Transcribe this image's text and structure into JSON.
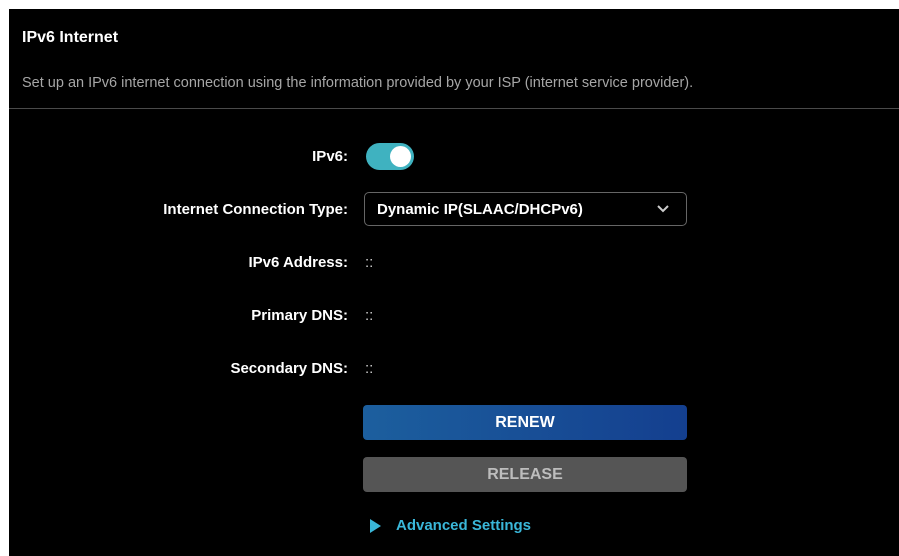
{
  "section": {
    "title": "IPv6 Internet",
    "description": "Set up an IPv6 internet connection using the information provided by your ISP (internet service provider)."
  },
  "ipv6": {
    "label": "IPv6:",
    "enabled": true
  },
  "connection_type": {
    "label": "Internet Connection Type:",
    "selected": "Dynamic IP(SLAAC/DHCPv6)"
  },
  "fields": {
    "ipv6_address": {
      "label": "IPv6 Address:",
      "value": "::"
    },
    "primary_dns": {
      "label": "Primary DNS:",
      "value": "::"
    },
    "secondary_dns": {
      "label": "Secondary DNS:",
      "value": "::"
    }
  },
  "buttons": {
    "renew": "RENEW",
    "release": "RELEASE"
  },
  "advanced": {
    "label": "Advanced Settings"
  },
  "colors": {
    "toggle_on": "#3fb2c0",
    "link": "#3ab7d9",
    "renew_button": "#1c5f9e",
    "release_button": "#555555"
  },
  "icons": {
    "select_chevron": "chevron-down-icon",
    "advanced_expand": "triangle-right-icon"
  }
}
